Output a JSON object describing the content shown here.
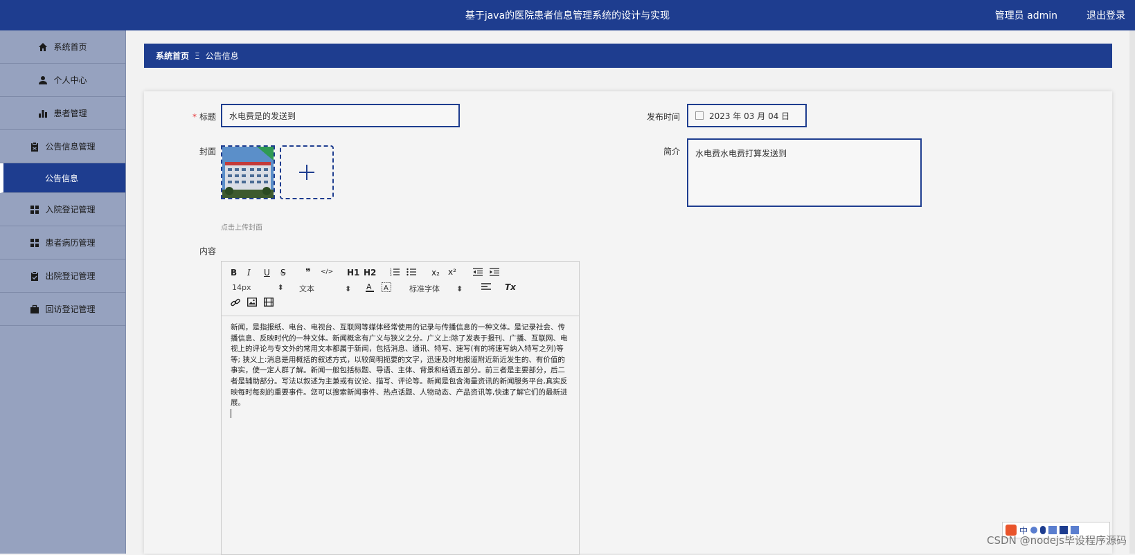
{
  "header": {
    "title": "基于java的医院患者信息管理系统的设计与实现",
    "user": "管理员 admin",
    "logout": "退出登录"
  },
  "sidebar": {
    "items": [
      {
        "label": "系统首页",
        "icon": "home-icon"
      },
      {
        "label": "个人中心",
        "icon": "user-icon"
      },
      {
        "label": "患者管理",
        "icon": "bar-chart-icon"
      },
      {
        "label": "公告信息管理",
        "icon": "clipboard-icon"
      },
      {
        "label": "公告信息",
        "icon": ""
      },
      {
        "label": "入院登记管理",
        "icon": "grid-icon"
      },
      {
        "label": "患者病历管理",
        "icon": "grid-icon"
      },
      {
        "label": "出院登记管理",
        "icon": "clipboard-check-icon"
      },
      {
        "label": "回访登记管理",
        "icon": "briefcase-icon"
      }
    ]
  },
  "breadcrumb": {
    "home": "系统首页",
    "separator": "Ξ",
    "current": "公告信息"
  },
  "form": {
    "title_label": "标题",
    "title_value": "水电费是的发送到",
    "cover_label": "封面",
    "cover_hint": "点击上传封面",
    "content_label": "内容",
    "publish_label": "发布时间",
    "publish_value": "2023 年 03 月 04 日",
    "intro_label": "简介",
    "intro_value": "水电费水电费打算发送到"
  },
  "editor": {
    "toolbar": {
      "bold": "B",
      "italic": "I",
      "underline": "U",
      "strike": "S",
      "quote": "❞",
      "code": "</>",
      "h1": "H1",
      "h2": "H2",
      "subscript": "x₂",
      "superscript": "x²",
      "size": "14px",
      "text_type": "文本",
      "font": "标准字体",
      "clear": "Tx"
    },
    "content": "新闻，是指报纸、电台、电视台、互联网等媒体经常使用的记录与传播信息的一种文体。是记录社会、传播信息、反映时代的一种文体。新闻概念有广义与狭义之分。广义上:除了发表于报刊、广播、互联网、电视上的评论与专文外的常用文本都属于新闻，包括消息、通讯、特写、速写(有的将速写纳入特写之列)等等; 狭义上:消息是用概括的叙述方式，以较简明扼要的文字，迅速及时地报道附近新近发生的、有价值的事实，使一定人群了解。新闻一般包括标题、导语、主体、背景和结语五部分。前三者是主要部分，后二者是辅助部分。写法以叙述为主兼或有议论、描写、评论等。新闻是包含海量资讯的新闻服务平台,真实反映每时每刻的重要事件。您可以搜索新闻事件、热点话题、人物动态、产品资讯等,快速了解它们的最新进展。"
  },
  "watermark": "CSDN @nodejs毕设程序源码",
  "ime": {
    "lang": "中"
  }
}
